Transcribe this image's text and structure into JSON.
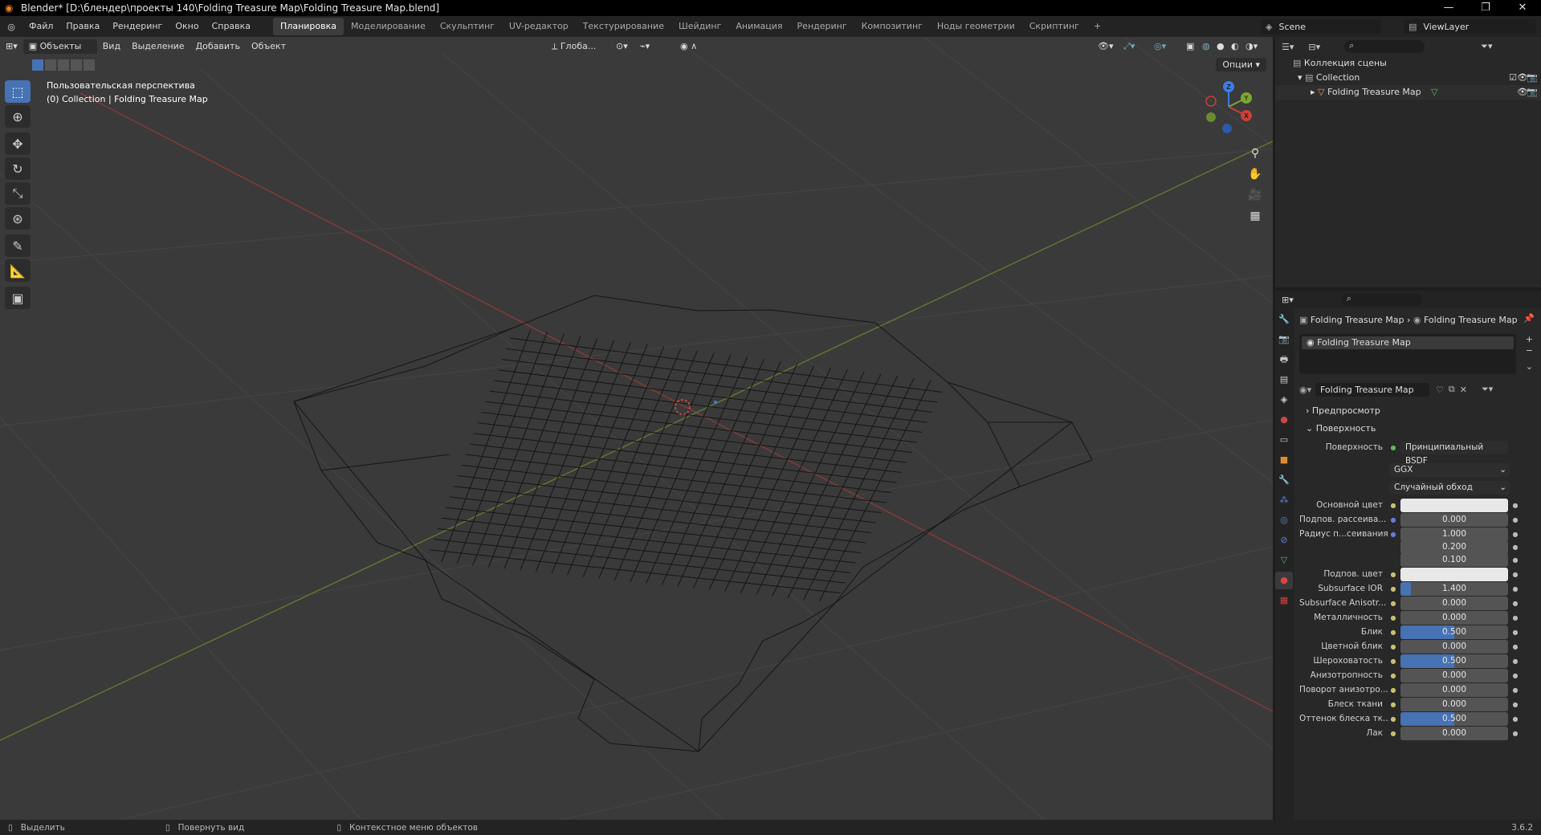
{
  "window": {
    "title": "Blender* [D:\\блендер\\проекты 140\\Folding Treasure Map\\Folding Treasure Map.blend]",
    "controls": [
      "—",
      "❐",
      "✕"
    ]
  },
  "menu": [
    "Файл",
    "Правка",
    "Рендеринг",
    "Окно",
    "Справка"
  ],
  "workspaces": [
    "Планировка",
    "Моделирование",
    "Скульптинг",
    "UV-редактор",
    "Текстурирование",
    "Шейдинг",
    "Анимация",
    "Рендеринг",
    "Композитинг",
    "Ноды геометрии",
    "Скриптинг",
    "+"
  ],
  "active_workspace": "Планировка",
  "scene": {
    "name": "Scene",
    "view_layer": "ViewLayer"
  },
  "viewport": {
    "mode": "Объекты",
    "header_menus": [
      "Вид",
      "Выделение",
      "Добавить",
      "Объект"
    ],
    "transform_orientation": "Глоба...",
    "options_label": "Опции",
    "info_line1": "Пользовательская перспектива",
    "info_line2": "(0) Collection | Folding Treasure Map",
    "gizmo": {
      "x": "X",
      "y": "Y",
      "z": "Z"
    }
  },
  "outliner": {
    "root": "Коллекция сцены",
    "collection": "Collection",
    "object": "Folding Treasure Map"
  },
  "properties": {
    "breadcrumb_object": "Folding Treasure Map",
    "breadcrumb_material": "Folding Treasure Map",
    "slot_name": "Folding Treasure Map",
    "material_name": "Folding Treasure Map",
    "section_preview": "Предпросмотр",
    "section_surface": "Поверхность",
    "surface_label": "Поверхность",
    "surface_value": "Принципиальный BSDF",
    "distribution": "GGX",
    "subsurface_method": "Случайный обход",
    "fields": [
      {
        "label": "Основной цвет",
        "value": "",
        "kind": "color"
      },
      {
        "label": "Подпов. рассеива...",
        "value": "0.000",
        "fill": 0
      },
      {
        "label": "Радиус п...сеивания",
        "value": "1.000",
        "fill": 0
      },
      {
        "label": "",
        "value": "0.200",
        "fill": 0
      },
      {
        "label": "",
        "value": "0.100",
        "fill": 0
      },
      {
        "label": "Подпов. цвет",
        "value": "",
        "kind": "color"
      },
      {
        "label": "Subsurface IOR",
        "value": "1.400",
        "fill": 0.1
      },
      {
        "label": "Subsurface Anisotr...",
        "value": "0.000",
        "fill": 0
      },
      {
        "label": "Металличность",
        "value": "0.000",
        "fill": 0
      },
      {
        "label": "Блик",
        "value": "0.500",
        "fill": 0.5
      },
      {
        "label": "Цветной блик",
        "value": "0.000",
        "fill": 0
      },
      {
        "label": "Шероховатость",
        "value": "0.500",
        "fill": 0.5
      },
      {
        "label": "Анизотропность",
        "value": "0.000",
        "fill": 0
      },
      {
        "label": "Поворот анизотро...",
        "value": "0.000",
        "fill": 0
      },
      {
        "label": "Блеск ткани",
        "value": "0.000",
        "fill": 0
      },
      {
        "label": "Оттенок блеска тк...",
        "value": "0.500",
        "fill": 0.5
      },
      {
        "label": "Лак",
        "value": "0.000",
        "fill": 0
      }
    ]
  },
  "statusbar": {
    "left": "Выделить",
    "middle": "Повернуть вид",
    "context": "Контекстное меню объектов",
    "version": "3.6.2"
  },
  "colors": {
    "accent": "#4772b3",
    "x_axis": "#c9403a",
    "y_axis": "#7da534",
    "z_axis": "#3d7de0"
  }
}
